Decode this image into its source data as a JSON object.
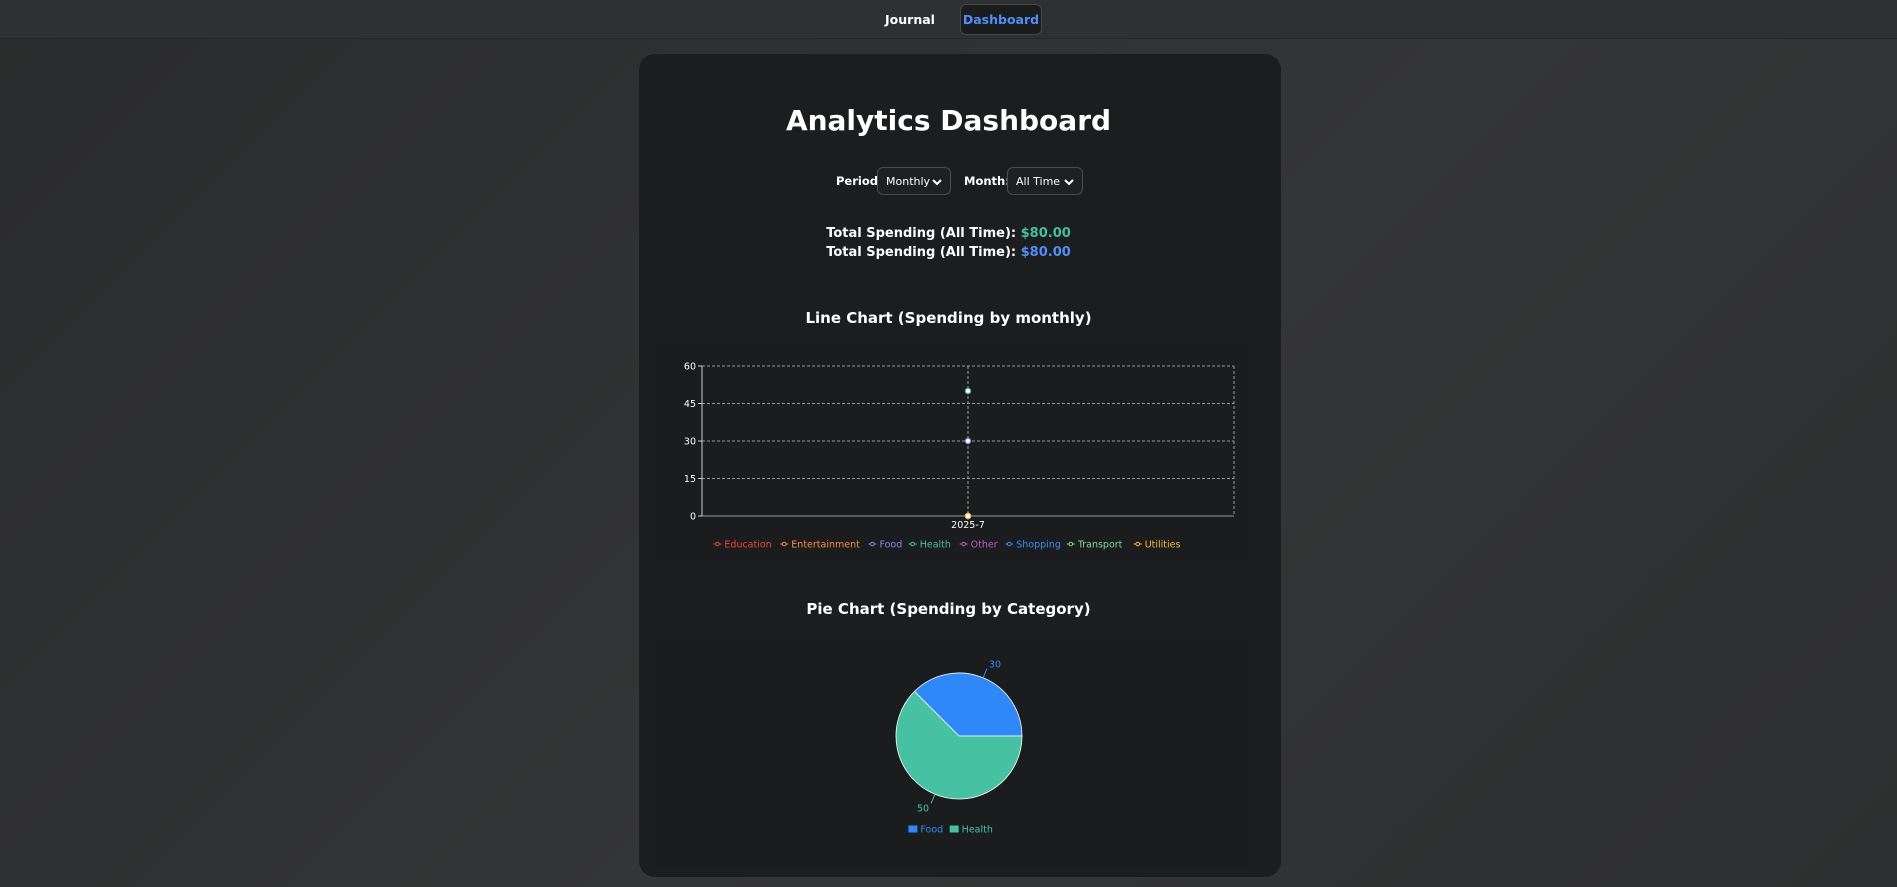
{
  "nav": {
    "journal_label": "Journal",
    "dashboard_label": "Dashboard"
  },
  "page": {
    "title": "Analytics Dashboard"
  },
  "filters": {
    "period_label": "Period:",
    "period_value": "Monthly",
    "month_label": "Month:",
    "month_value": "All Time"
  },
  "totals": [
    {
      "label": "Total Spending (All Time):",
      "value": "$80.00",
      "color": "#44c09e"
    },
    {
      "label": "Total Spending (All Time):",
      "value": "$80.00",
      "color": "#4f8ff7"
    }
  ],
  "line_section": {
    "title": "Line Chart (Spending by monthly)"
  },
  "pie_section": {
    "title": "Pie Chart (Spending by Category)"
  },
  "chart_data": [
    {
      "type": "line",
      "title": "Line Chart (Spending by monthly)",
      "categories": [
        "2025-7"
      ],
      "ylim": [
        0,
        60
      ],
      "yticks": [
        0,
        15,
        30,
        45,
        60
      ],
      "grid": true,
      "legend_position": "bottom",
      "series": [
        {
          "name": "Education",
          "values": [
            0
          ],
          "color": "#f0453a"
        },
        {
          "name": "Entertainment",
          "values": [
            0
          ],
          "color": "#f98c3c"
        },
        {
          "name": "Food",
          "values": [
            30
          ],
          "color": "#8b86f0"
        },
        {
          "name": "Health",
          "values": [
            50
          ],
          "color": "#44c09e"
        },
        {
          "name": "Other",
          "values": [
            0
          ],
          "color": "#c05ec6"
        },
        {
          "name": "Shopping",
          "values": [
            0
          ],
          "color": "#3b8cf5"
        },
        {
          "name": "Transport",
          "values": [
            0
          ],
          "color": "#7fd6a0"
        },
        {
          "name": "Utilities",
          "values": [
            0
          ],
          "color": "#f5bd3c"
        }
      ]
    },
    {
      "type": "pie",
      "title": "Pie Chart (Spending by Category)",
      "legend_position": "bottom",
      "slices": [
        {
          "name": "Food",
          "value": 30,
          "color": "#2f88f8"
        },
        {
          "name": "Health",
          "value": 50,
          "color": "#46c2a2"
        }
      ]
    }
  ]
}
